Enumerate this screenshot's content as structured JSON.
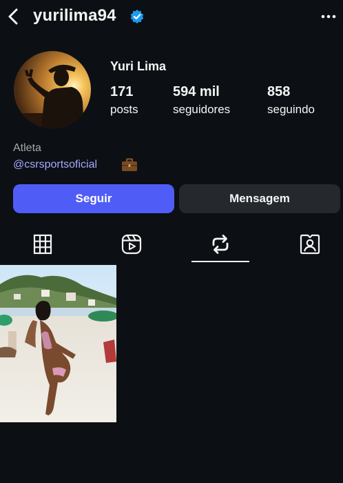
{
  "header": {
    "username": "yurilima94",
    "back_icon": "chevron-left-icon",
    "verified_icon": "verified-badge-icon",
    "more_icon": "more-horizontal-icon",
    "verified_color": "#1d9bf0"
  },
  "profile": {
    "full_name": "Yuri Lima",
    "stats": [
      {
        "value": "171",
        "label": "posts"
      },
      {
        "value": "594 mil",
        "label": "seguidores"
      },
      {
        "value": "858",
        "label": "seguindo"
      }
    ],
    "category": "Atleta",
    "link": "@csrsportsoficial",
    "link_icon": "briefcase-emoji"
  },
  "actions": {
    "follow_label": "Seguir",
    "message_label": "Mensagem",
    "follow_color": "#4f5df6"
  },
  "tabs": [
    {
      "icon": "grid-icon",
      "active": false
    },
    {
      "icon": "reels-icon",
      "active": false
    },
    {
      "icon": "reposts-icon",
      "active": true
    },
    {
      "icon": "tagged-icon",
      "active": false
    }
  ],
  "posts": [
    {
      "description_icon": "beach-photo"
    }
  ]
}
